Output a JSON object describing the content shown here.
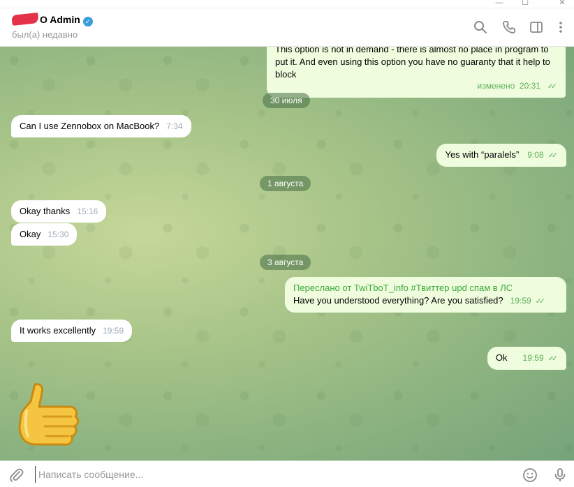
{
  "window": {
    "minimize_glyph": "—",
    "maximize_glyph": "☐",
    "close_glyph": "✕"
  },
  "header": {
    "title_suffix": "O Admin",
    "status": "был(а) недавно",
    "icons": [
      "search-icon",
      "phone-icon",
      "sidebar-toggle-icon",
      "more-vertical-icon"
    ]
  },
  "messages": {
    "m1": {
      "text": "This option is not in demand - there is almost no place in program to put it. And even using this option you have no guaranty that it help to block",
      "edited_label": "изменено",
      "time": "20:31"
    },
    "d1": "30 июля",
    "m2": {
      "text": "Can I use Zennobox on MacBook?",
      "time": "7:34"
    },
    "m3": {
      "text": "Yes with “paralels”",
      "time": "9:08"
    },
    "d2": "1 августа",
    "m4": {
      "text": "Okay thanks",
      "time": "15:16"
    },
    "m5": {
      "text": "Okay",
      "time": "15:30"
    },
    "d3": "3 августа",
    "m6": {
      "forwarded": "Переслано от TwiTboT_info #Твиттер upd спам в ЛС",
      "text": "Have you understood everything? Are you satisfied?",
      "time": "19:59"
    },
    "m7": {
      "text": "It works excellently",
      "time": "19:59"
    },
    "m8": {
      "text": "Ok",
      "time": "19:59"
    },
    "sticker": "thumbs-up-sticker"
  },
  "composer": {
    "placeholder": "Написать сообщение...",
    "value": ""
  },
  "colors": {
    "outgoing_bubble": "#effdde",
    "incoming_bubble": "#ffffff",
    "accent_green": "#5fae5a",
    "verified_blue": "#3a9fd8"
  }
}
